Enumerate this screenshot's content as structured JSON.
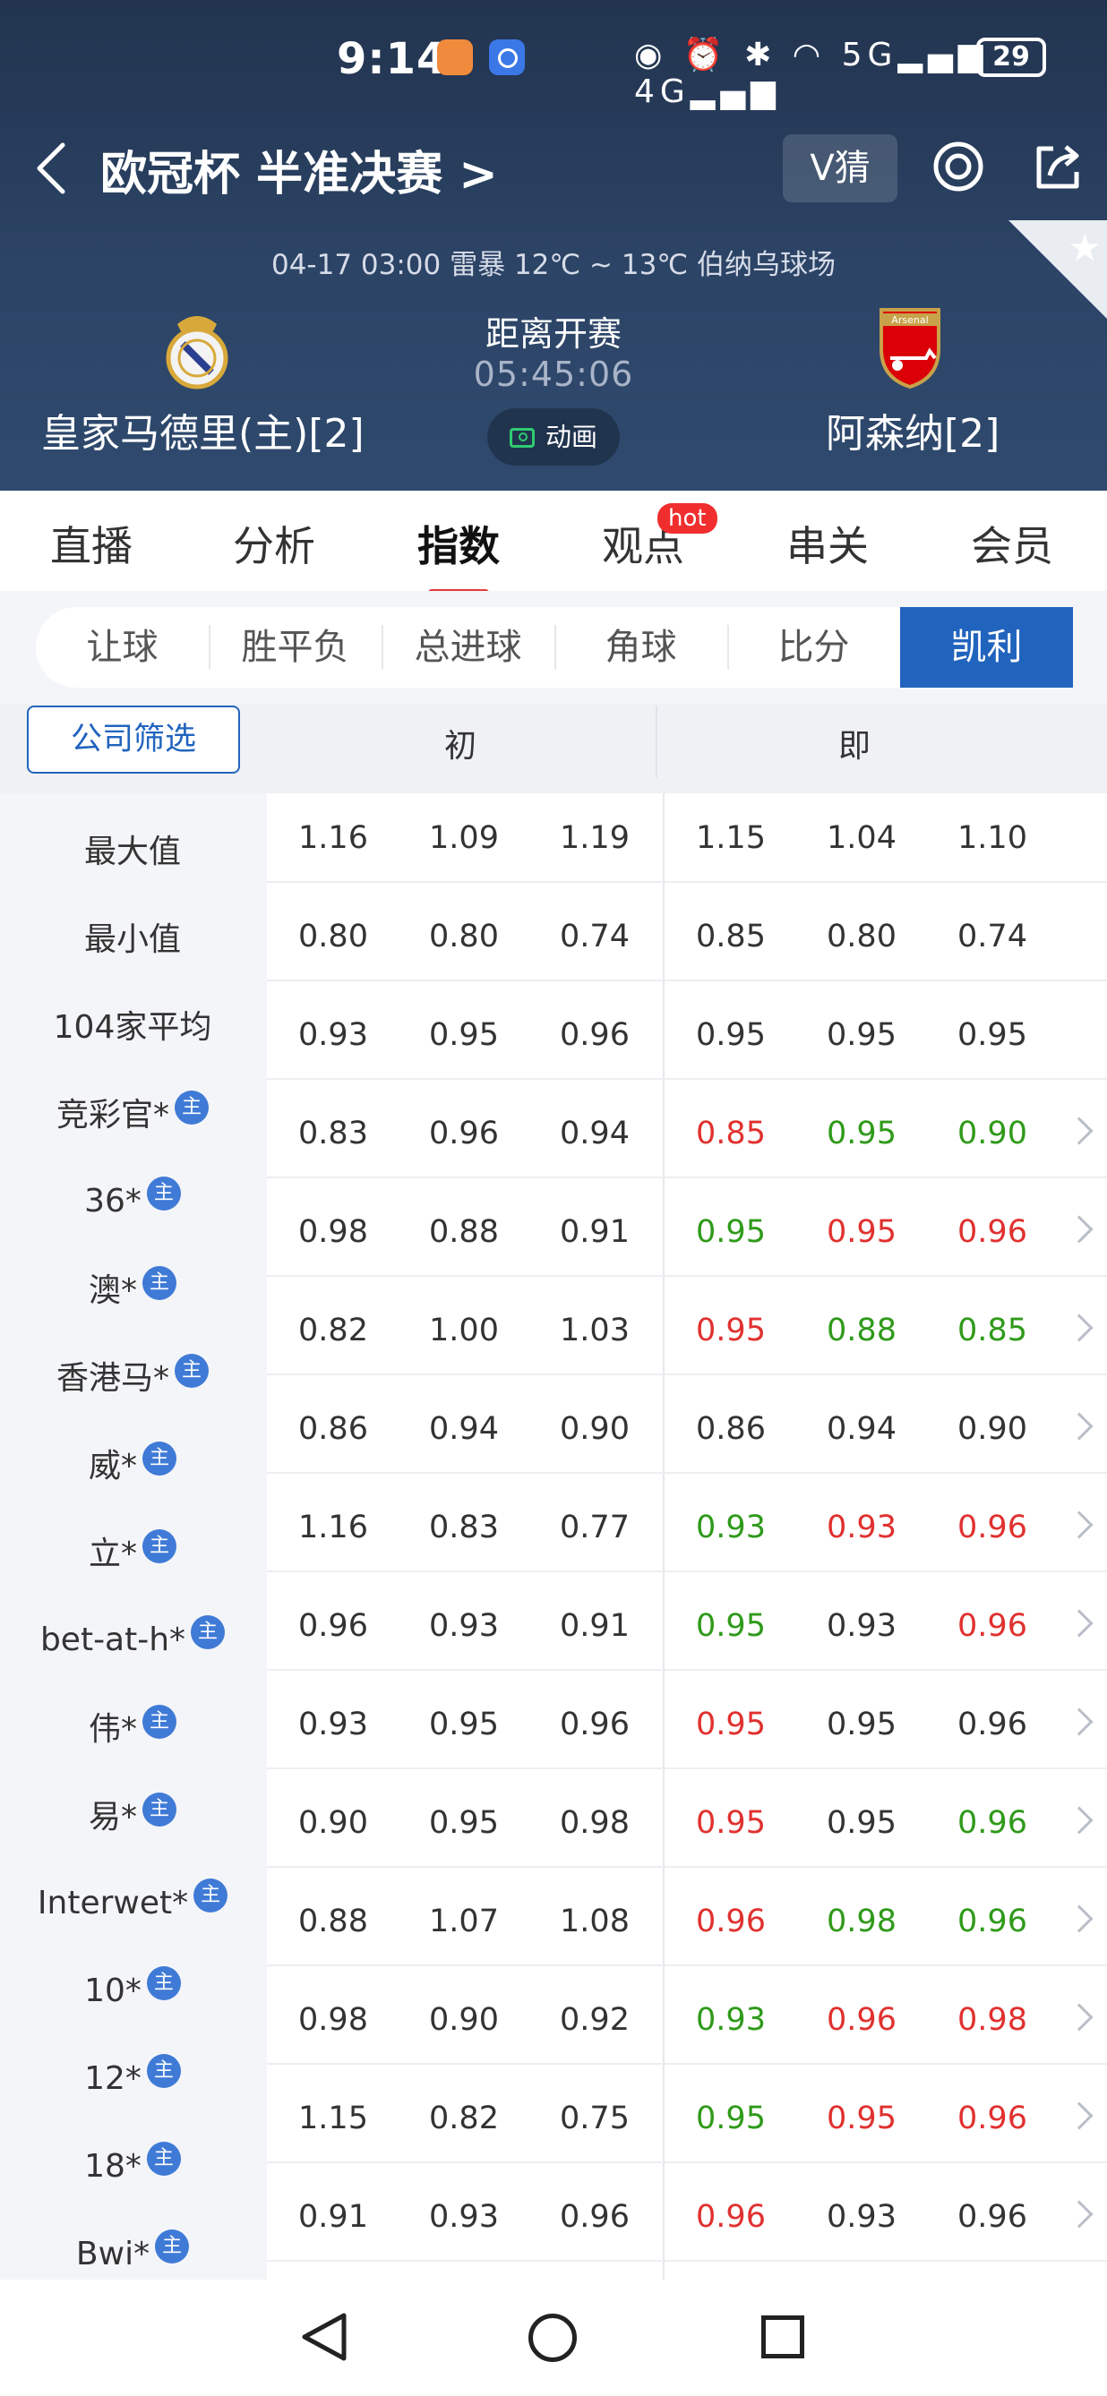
{
  "status_bar": {
    "time": "9:14",
    "icons": "◉ ⏰ ✱ ◠ 5G▂▄▆ 4G▂▄▆",
    "battery": "29"
  },
  "nav": {
    "title": "欧冠杯 半准决赛 >",
    "v_guess": "V猜",
    "fav_icon": "★"
  },
  "match": {
    "info": "04-17 03:00   雷暴 12℃ ~ 13℃   伯纳乌球场",
    "home_name": "皇家马德里(主)[2]",
    "away_name": "阿森纳[2]",
    "away_logo_text": "Arsenal",
    "countdown_label": "距离开赛",
    "countdown": "05:45:06",
    "animation_label": "动画"
  },
  "main_tabs": [
    "直播",
    "分析",
    "指数",
    "观点",
    "串关",
    "会员"
  ],
  "main_tab_hot": "hot",
  "sub_tabs": [
    "让球",
    "胜平负",
    "总进球",
    "角球",
    "比分",
    "凯利"
  ],
  "column_header": {
    "filter": "公司筛选",
    "initial": "初",
    "current": "即"
  },
  "badge_text": "主",
  "rows": [
    {
      "name": "最大值",
      "badge": false,
      "init": [
        "1.16",
        "1.09",
        "1.19"
      ],
      "now": [
        "1.15",
        "1.04",
        "1.10"
      ],
      "colors": [
        "black",
        "black",
        "black"
      ],
      "chevron": false
    },
    {
      "name": "最小值",
      "badge": false,
      "init": [
        "0.80",
        "0.80",
        "0.74"
      ],
      "now": [
        "0.85",
        "0.80",
        "0.74"
      ],
      "colors": [
        "black",
        "black",
        "black"
      ],
      "chevron": false
    },
    {
      "name": "104家平均",
      "badge": false,
      "init": [
        "0.93",
        "0.95",
        "0.96"
      ],
      "now": [
        "0.95",
        "0.95",
        "0.95"
      ],
      "colors": [
        "black",
        "black",
        "black"
      ],
      "chevron": false
    },
    {
      "name": "竞彩官*",
      "badge": true,
      "init": [
        "0.83",
        "0.96",
        "0.94"
      ],
      "now": [
        "0.85",
        "0.95",
        "0.90"
      ],
      "colors": [
        "red",
        "green",
        "green"
      ],
      "chevron": true
    },
    {
      "name": "36*",
      "badge": true,
      "init": [
        "0.98",
        "0.88",
        "0.91"
      ],
      "now": [
        "0.95",
        "0.95",
        "0.96"
      ],
      "colors": [
        "green",
        "red",
        "red"
      ],
      "chevron": true
    },
    {
      "name": "澳*",
      "badge": true,
      "init": [
        "0.82",
        "1.00",
        "1.03"
      ],
      "now": [
        "0.95",
        "0.88",
        "0.85"
      ],
      "colors": [
        "red",
        "green",
        "green"
      ],
      "chevron": true
    },
    {
      "name": "香港马*",
      "badge": true,
      "init": [
        "0.86",
        "0.94",
        "0.90"
      ],
      "now": [
        "0.86",
        "0.94",
        "0.90"
      ],
      "colors": [
        "black",
        "black",
        "black"
      ],
      "chevron": true
    },
    {
      "name": "威*",
      "badge": true,
      "init": [
        "1.16",
        "0.83",
        "0.77"
      ],
      "now": [
        "0.93",
        "0.93",
        "0.96"
      ],
      "colors": [
        "green",
        "red",
        "red"
      ],
      "chevron": true
    },
    {
      "name": "立*",
      "badge": true,
      "init": [
        "0.96",
        "0.93",
        "0.91"
      ],
      "now": [
        "0.95",
        "0.93",
        "0.96"
      ],
      "colors": [
        "green",
        "black",
        "red"
      ],
      "chevron": true
    },
    {
      "name": "bet-at-h*",
      "badge": true,
      "init": [
        "0.93",
        "0.95",
        "0.96"
      ],
      "now": [
        "0.95",
        "0.95",
        "0.96"
      ],
      "colors": [
        "red",
        "black",
        "black"
      ],
      "chevron": true
    },
    {
      "name": "伟*",
      "badge": true,
      "init": [
        "0.90",
        "0.95",
        "0.98"
      ],
      "now": [
        "0.95",
        "0.95",
        "0.96"
      ],
      "colors": [
        "red",
        "black",
        "green"
      ],
      "chevron": true
    },
    {
      "name": "易*",
      "badge": true,
      "init": [
        "0.88",
        "1.07",
        "1.08"
      ],
      "now": [
        "0.96",
        "0.98",
        "0.96"
      ],
      "colors": [
        "red",
        "green",
        "green"
      ],
      "chevron": true
    },
    {
      "name": "Interwet*",
      "badge": true,
      "init": [
        "0.98",
        "0.90",
        "0.92"
      ],
      "now": [
        "0.93",
        "0.96",
        "0.98"
      ],
      "colors": [
        "green",
        "red",
        "red"
      ],
      "chevron": true
    },
    {
      "name": "10*",
      "badge": true,
      "init": [
        "1.15",
        "0.82",
        "0.75"
      ],
      "now": [
        "0.95",
        "0.95",
        "0.96"
      ],
      "colors": [
        "green",
        "red",
        "red"
      ],
      "chevron": true
    },
    {
      "name": "12*",
      "badge": true,
      "init": [
        "0.91",
        "0.93",
        "0.96"
      ],
      "now": [
        "0.96",
        "0.93",
        "0.96"
      ],
      "colors": [
        "red",
        "black",
        "black"
      ],
      "chevron": true
    },
    {
      "name": "18*",
      "badge": true,
      "init": [],
      "now": [],
      "colors": [],
      "chevron": false
    },
    {
      "name": "Bwi*",
      "badge": true,
      "init": [],
      "now": [],
      "colors": [],
      "chevron": false
    }
  ]
}
